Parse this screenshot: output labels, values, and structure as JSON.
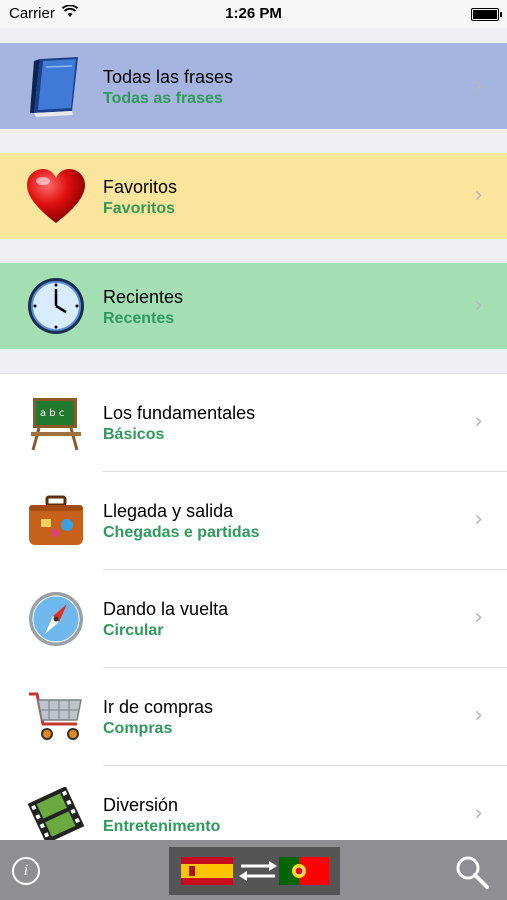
{
  "status_bar": {
    "carrier": "Carrier",
    "time": "1:26 PM"
  },
  "menu": [
    {
      "title": "Todas las frases",
      "subtitle": "Todas as frases",
      "icon": "book-icon",
      "color": "#a6b4e0"
    },
    {
      "title": "Favoritos",
      "subtitle": "Favoritos",
      "icon": "heart-icon",
      "color": "#fbe49b"
    },
    {
      "title": "Recientes",
      "subtitle": "Recentes",
      "icon": "clock-icon",
      "color": "#a4dfb4"
    }
  ],
  "categories": [
    {
      "title": "Los fundamentales",
      "subtitle": "Básicos",
      "icon": "chalkboard-icon"
    },
    {
      "title": "Llegada y salida",
      "subtitle": "Chegadas e partidas",
      "icon": "suitcase-icon"
    },
    {
      "title": "Dando la vuelta",
      "subtitle": "Circular",
      "icon": "compass-icon"
    },
    {
      "title": "Ir de compras",
      "subtitle": "Compras",
      "icon": "shopping-cart-icon"
    },
    {
      "title": "Diversión",
      "subtitle": "Entretenimento",
      "icon": "film-icon"
    }
  ],
  "toolbar": {
    "info_icon": "info-icon",
    "source_flag": "spain-flag-icon",
    "target_flag": "portugal-flag-icon",
    "swap_icon": "swap-arrows-icon",
    "search_icon": "search-icon",
    "info_glyph": "i"
  }
}
